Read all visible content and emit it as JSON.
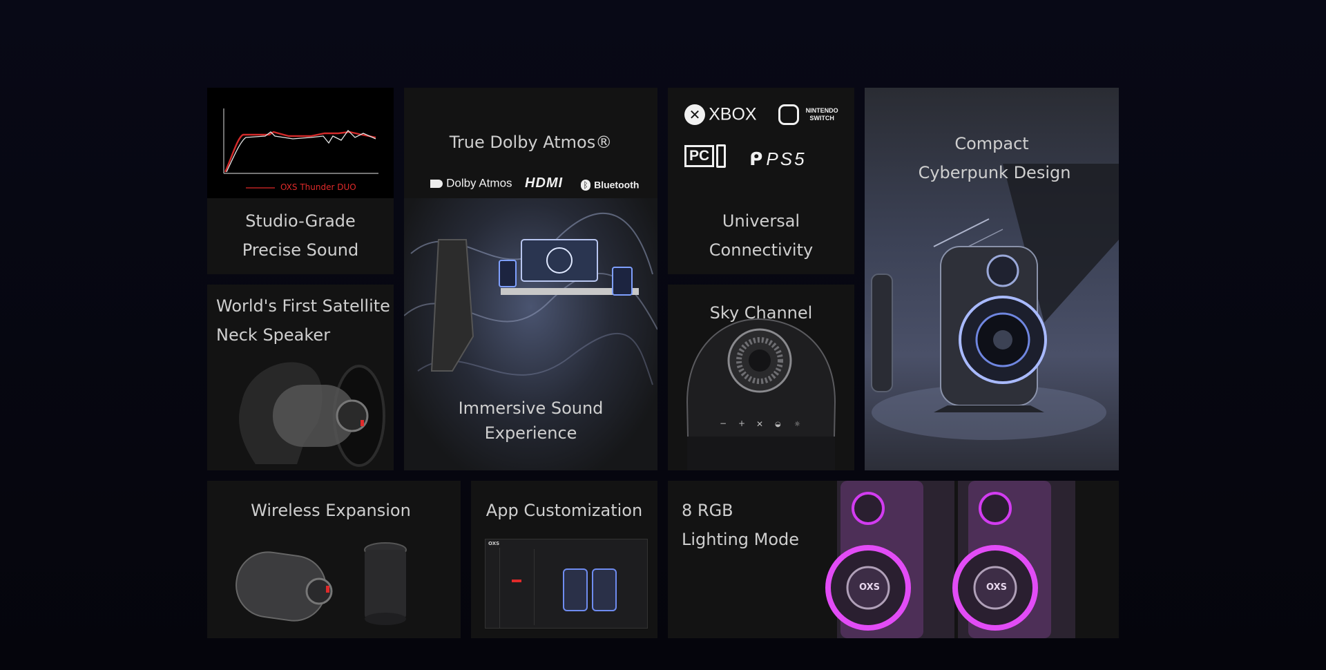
{
  "cards": {
    "studio": {
      "legend": "OXS Thunder DUO",
      "title_line1": "Studio-Grade",
      "title_line2": "Precise Sound"
    },
    "dolby": {
      "title": "True Dolby Atmos®",
      "logos": [
        "Dolby Atmos",
        "HDMI",
        "Bluetooth"
      ],
      "subtitle_line1": "Immersive Sound",
      "subtitle_line2": "Experience"
    },
    "platforms": {
      "logos": [
        "XBOX",
        "NINTENDO SWITCH",
        "PC",
        "PS5"
      ],
      "title_line1": "Universal",
      "title_line2": "Connectivity"
    },
    "compact": {
      "title_line1": "Compact",
      "title_line2": "Cyberpunk Design"
    },
    "satellite": {
      "title_line1": "World's First Satellite",
      "title_line2": "Neck Speaker"
    },
    "sky": {
      "title": "Sky Channel"
    },
    "wireless": {
      "title": "Wireless Expansion"
    },
    "app": {
      "title": "App Customization",
      "app_brand": "OXS"
    },
    "rgb": {
      "title_line1": "8 RGB",
      "title_line2": "Lighting Mode",
      "speaker_brand": "OXS"
    }
  },
  "colors": {
    "page_bg": "#080916",
    "card_bg": "#131313",
    "accent_red": "#e02a2a",
    "rgb_magenta": "#d23cf0",
    "glow_blue": "#8fa8ff"
  }
}
